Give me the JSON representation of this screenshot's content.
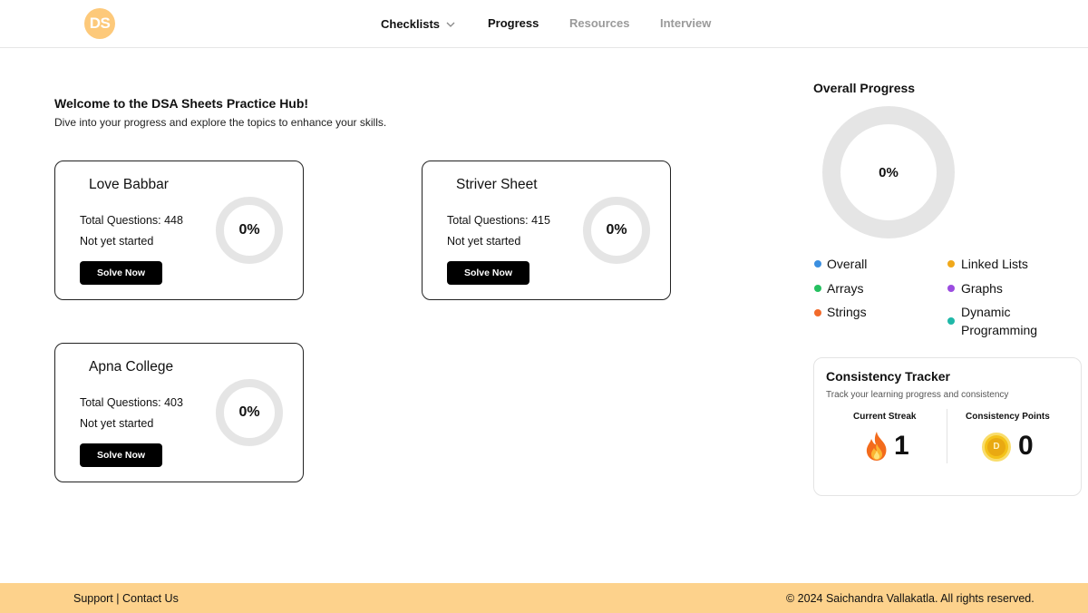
{
  "header": {
    "logo_text": "DS",
    "nav": [
      {
        "label": "Checklists"
      },
      {
        "label": "Progress"
      },
      {
        "label": "Resources"
      },
      {
        "label": "Interview"
      }
    ]
  },
  "welcome": {
    "title": "Welcome to the DSA Sheets Practice Hub!",
    "subtitle": "Dive into your progress and explore the topics to enhance your skills."
  },
  "sheets": [
    {
      "title": "Love Babbar",
      "total": "Total Questions: 448",
      "status": "Not yet started",
      "button": "Solve Now",
      "progress": "0%"
    },
    {
      "title": "Striver Sheet",
      "total": "Total Questions: 415",
      "status": "Not yet started",
      "button": "Solve Now",
      "progress": "0%"
    },
    {
      "title": "Apna College",
      "total": "Total Questions: 403",
      "status": "Not yet started",
      "button": "Solve Now",
      "progress": "0%"
    }
  ],
  "overall": {
    "title": "Overall Progress",
    "progress": "0%",
    "legend": [
      {
        "label": "Overall",
        "color": "#3b8fe0"
      },
      {
        "label": "Arrays",
        "color": "#26c060"
      },
      {
        "label": "Strings",
        "color": "#f26a2a"
      },
      {
        "label": "Linked Lists",
        "color": "#f0a81a"
      },
      {
        "label": "Graphs",
        "color": "#9b4ce0"
      },
      {
        "label": "Dynamic Programming",
        "color": "#1fb8a8"
      }
    ]
  },
  "tracker": {
    "title": "Consistency Tracker",
    "subtitle": "Track your learning progress and consistency",
    "streak_label": "Current Streak",
    "streak_value": "1",
    "points_label": "Consistency Points",
    "points_value": "0",
    "coin_letter": "D"
  },
  "footer": {
    "support": "Support",
    "separator": "|",
    "contact": "Contact Us",
    "copyright": "© 2024 Saichandra Vallakatla. All rights reserved."
  },
  "colors": {
    "accent": "#fdd28c",
    "logo": "#fdc97a",
    "ring_track": "#e5e5e5"
  }
}
